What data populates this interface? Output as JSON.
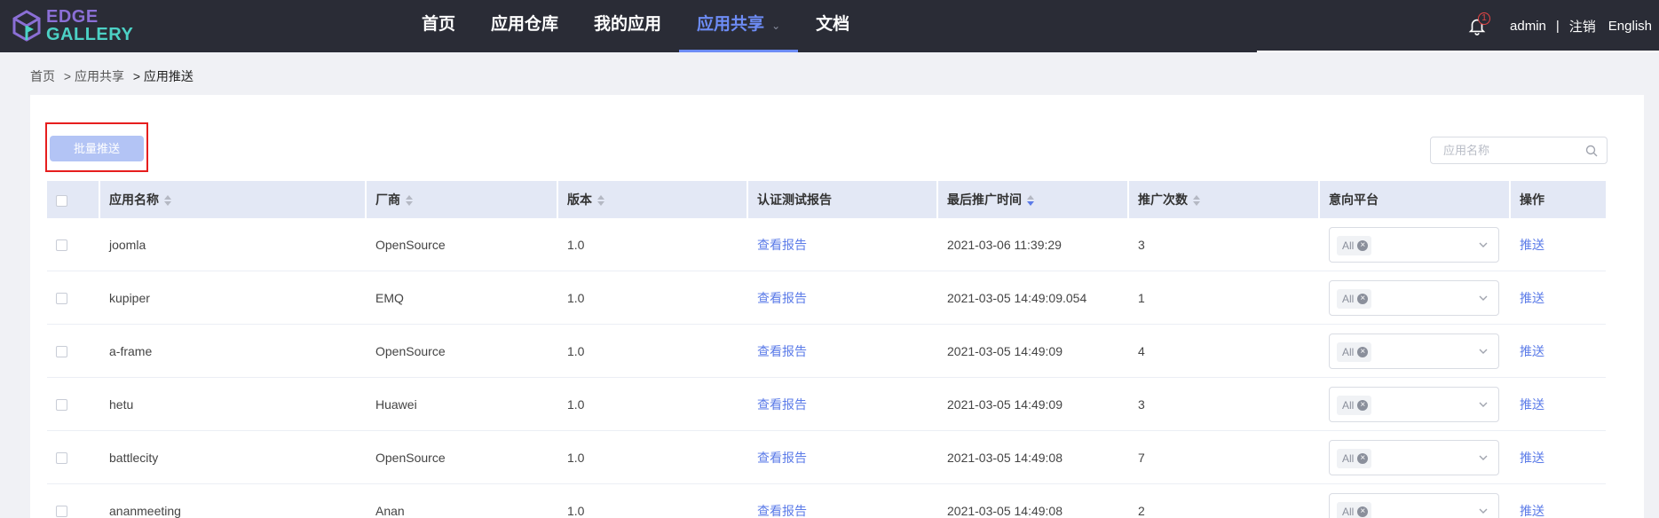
{
  "header": {
    "logo": {
      "line1": "EDGE",
      "line2": "GALLERY"
    },
    "nav": [
      {
        "label": "首页",
        "active": false
      },
      {
        "label": "应用仓库",
        "active": false
      },
      {
        "label": "我的应用",
        "active": false
      },
      {
        "label": "应用共享",
        "active": true,
        "has_dropdown": true
      },
      {
        "label": "文档",
        "active": false
      }
    ],
    "notification_count": "1",
    "user": "admin",
    "separator": "|",
    "logout": "注销",
    "language": "English"
  },
  "breadcrumb": [
    "首页",
    "> 应用共享",
    "> 应用推送"
  ],
  "toolbar": {
    "batch_push_label": "批量推送",
    "search_placeholder": "应用名称"
  },
  "table": {
    "columns": [
      "应用名称",
      "厂商",
      "版本",
      "认证测试报告",
      "最后推广时间",
      "推广次数",
      "意向平台",
      "操作"
    ],
    "sortable": [
      true,
      true,
      true,
      false,
      true,
      true,
      false,
      false
    ],
    "sorted_column": "最后推广时间",
    "sort_order": "desc",
    "rows": [
      {
        "name": "joomla",
        "vendor": "OpenSource",
        "version": "1.0",
        "report": "查看报告",
        "last_time": "2021-03-06 11:39:29",
        "count": "3",
        "platform": "All",
        "action": "推送"
      },
      {
        "name": "kupiper",
        "vendor": "EMQ",
        "version": "1.0",
        "report": "查看报告",
        "last_time": "2021-03-05 14:49:09.054",
        "count": "1",
        "platform": "All",
        "action": "推送"
      },
      {
        "name": "a-frame",
        "vendor": "OpenSource",
        "version": "1.0",
        "report": "查看报告",
        "last_time": "2021-03-05 14:49:09",
        "count": "4",
        "platform": "All",
        "action": "推送"
      },
      {
        "name": "hetu",
        "vendor": "Huawei",
        "version": "1.0",
        "report": "查看报告",
        "last_time": "2021-03-05 14:49:09",
        "count": "3",
        "platform": "All",
        "action": "推送"
      },
      {
        "name": "battlecity",
        "vendor": "OpenSource",
        "version": "1.0",
        "report": "查看报告",
        "last_time": "2021-03-05 14:49:08",
        "count": "7",
        "platform": "All",
        "action": "推送"
      },
      {
        "name": "ananmeeting",
        "vendor": "Anan",
        "version": "1.0",
        "report": "查看报告",
        "last_time": "2021-03-05 14:49:08",
        "count": "2",
        "platform": "All",
        "action": "推送"
      }
    ]
  },
  "colors": {
    "topbar": "#2a2c36",
    "accent": "#5b7be8",
    "header_row": "#e3e8f5",
    "highlight_box": "#e61e1e"
  }
}
